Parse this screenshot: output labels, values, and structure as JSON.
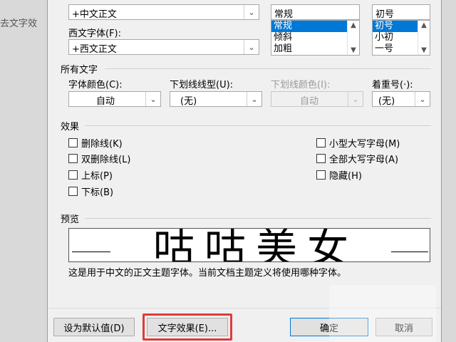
{
  "background": {
    "text": "去文字效"
  },
  "font_top": {
    "chinese_font_value": "+中文正文",
    "style_value": "常规",
    "size_value": "初号"
  },
  "western_font": {
    "label": "西文字体(F):",
    "value": "+西文正文"
  },
  "style_list": {
    "items": [
      "常规",
      "倾斜",
      "加粗"
    ],
    "selected": "常规"
  },
  "size_list": {
    "items": [
      "初号",
      "小初",
      "一号"
    ],
    "selected": "初号"
  },
  "all_text": {
    "title": "所有文字",
    "font_color": {
      "label": "字体颜色(C):",
      "value": "自动"
    },
    "underline_type": {
      "label": "下划线线型(U):",
      "value": "(无)"
    },
    "underline_color": {
      "label": "下划线颜色(I):",
      "value": "自动"
    },
    "emphasis": {
      "label": "着重号(·):",
      "value": "(无)"
    }
  },
  "effects": {
    "title": "效果",
    "left": [
      "删除线(K)",
      "双删除线(L)",
      "上标(P)",
      "下标(B)"
    ],
    "right": [
      "小型大写字母(M)",
      "全部大写字母(A)",
      "隐藏(H)"
    ]
  },
  "preview": {
    "title": "预览",
    "sample": "咕咕美女",
    "description": "这是用于中文的正文主题字体。当前文档主题定义将使用哪种字体。"
  },
  "buttons": {
    "set_default": "设为默认值(D)",
    "text_effects": "文字效果(E)...",
    "ok": "确定",
    "cancel": "取消"
  },
  "colors": {
    "selection": "#0078d7",
    "highlight": "#e03a3a"
  }
}
